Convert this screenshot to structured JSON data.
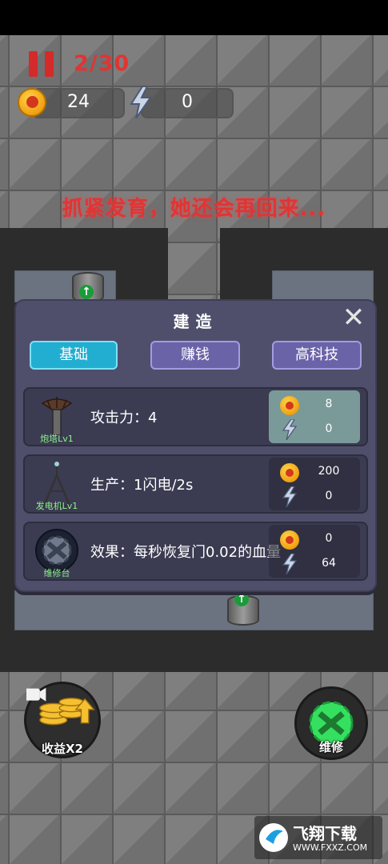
{
  "hud": {
    "wave": "2/30",
    "coins": "24",
    "energy": "0"
  },
  "banner_text": "抓紧发育，她还会再回来...",
  "build_panel": {
    "title": "建造",
    "tabs": [
      {
        "label": "基础",
        "active": true
      },
      {
        "label": "赚钱",
        "active": false
      },
      {
        "label": "高科技",
        "active": false
      }
    ],
    "items": [
      {
        "name": "炮塔Lv1",
        "icon": "turret-icon",
        "desc": "攻击力：4",
        "coin_cost": "8",
        "energy_cost": "0",
        "affordable": true
      },
      {
        "name": "发电机Lv1",
        "icon": "generator-tower-icon",
        "desc": "生产：1闪电/2s",
        "coin_cost": "200",
        "energy_cost": "0",
        "affordable": false
      },
      {
        "name": "维修台",
        "icon": "repair-gear-icon",
        "desc": "效果：每秒恢复门0.02的血量",
        "coin_cost": "0",
        "energy_cost": "64",
        "affordable": false
      }
    ]
  },
  "buttons": {
    "income": "收益X2",
    "repair": "维修"
  },
  "watermark": {
    "title": "飞翔下载",
    "url": "WWW.FXXZ.COM"
  },
  "colors": {
    "accent_red": "#e13434",
    "panel_bg": "#4f4f6b",
    "tab_active": "#21aed1",
    "tab_idle": "#6b63a8",
    "repair_green": "#35e060"
  }
}
